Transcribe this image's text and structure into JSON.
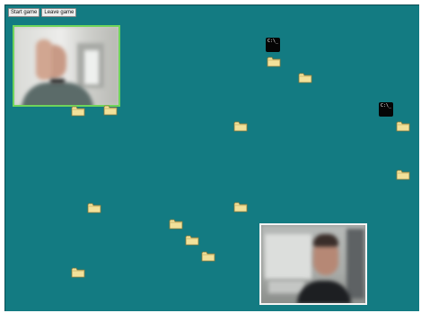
{
  "toolbar": {
    "start_label": "Start game",
    "leave_label": "Leave game"
  },
  "terminals": [
    {
      "label": "C:\\_"
    },
    {
      "label": "C:\\_"
    }
  ],
  "colors": {
    "board": "#137b82",
    "active_video_border": "#6fd45a",
    "video_border": "#f4f4f4",
    "folder": "#f2e19a"
  }
}
